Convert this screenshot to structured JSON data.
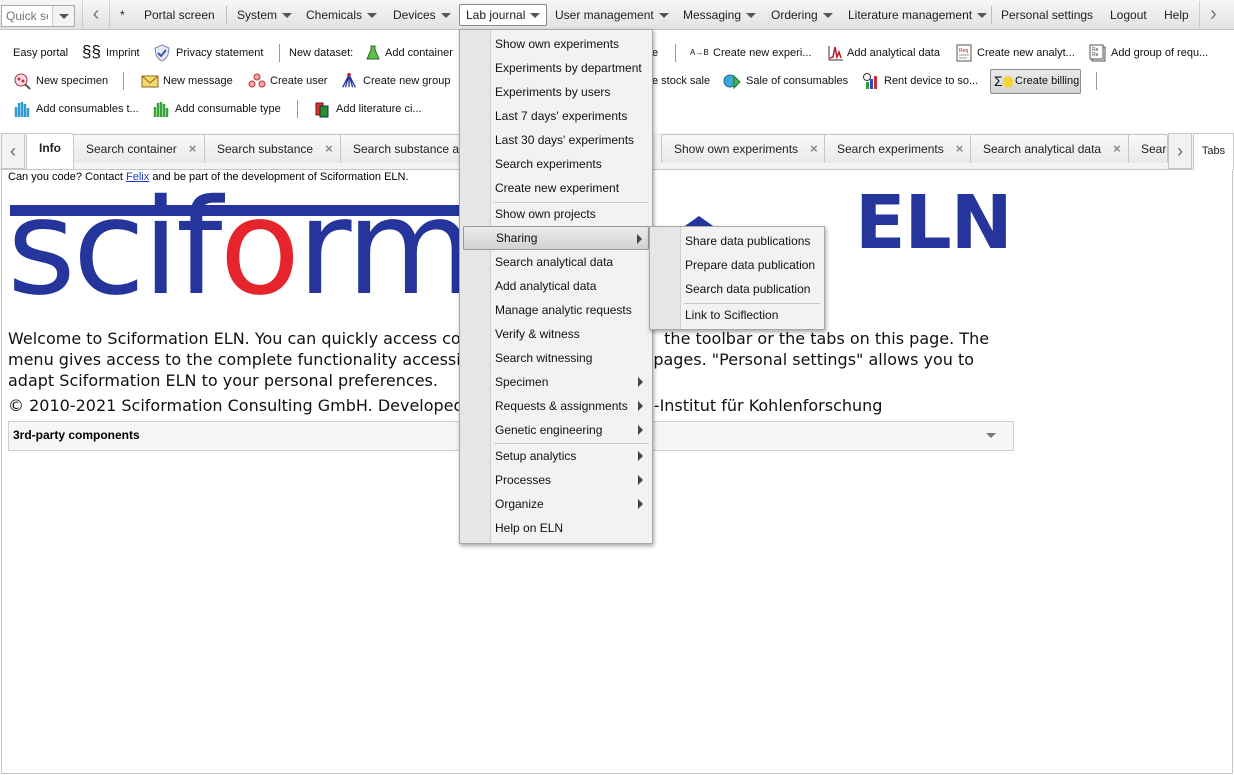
{
  "quick_search": {
    "placeholder": "Quick search"
  },
  "menubar": {
    "star": "*",
    "items": [
      {
        "label": "Portal screen"
      },
      {
        "label": "System"
      },
      {
        "label": "Chemicals"
      },
      {
        "label": "Devices"
      },
      {
        "label": "Lab journal"
      },
      {
        "label": "User management"
      },
      {
        "label": "Messaging"
      },
      {
        "label": "Ordering"
      },
      {
        "label": "Literature management"
      },
      {
        "label": "Personal settings"
      },
      {
        "label": "Logout"
      },
      {
        "label": "Help"
      }
    ]
  },
  "toolbar": {
    "row1": {
      "easy_portal": "Easy portal",
      "imprint": "Imprint",
      "privacy": "Privacy statement",
      "new_dataset": "New dataset:",
      "add_container": "Add container",
      "add_trunc": "e",
      "create_experiment": "Create new experi...",
      "add_analytical_data": "Add analytical data",
      "create_analytical": "Create new analyt...",
      "add_group_requests": "Add group of requ..."
    },
    "row2": {
      "new_specimen": "New specimen",
      "new_message": "New message",
      "create_user": "Create user",
      "create_group": "Create new group",
      "stock_sale": "e stock sale",
      "sale_consumables": "Sale of consumables",
      "rent_device": "Rent device to so...",
      "create_billing": "Create billing"
    },
    "row3": {
      "add_consumables": "Add consumables t...",
      "add_consumable_type": "Add consumable type",
      "add_literature": "Add literature ci..."
    }
  },
  "tabs": [
    {
      "label": "Info"
    },
    {
      "label": "Search container"
    },
    {
      "label": "Search substance"
    },
    {
      "label": "Search substance a"
    },
    {
      "label": "Show own experiments"
    },
    {
      "label": "Search experiments"
    },
    {
      "label": "Search analytical data"
    },
    {
      "label": "Searc"
    }
  ],
  "tabs_button": "Tabs",
  "content": {
    "contact_pre": "Can you code? Contact ",
    "contact_link": "Felix",
    "contact_post": " and be part of the development of Sciformation ELN.",
    "logo_eln": "ELN",
    "welcome": "Welcome to Sciformation ELN. You can quickly access co                                        the toolbar or the tabs on this page. The menu gives access to the complete functionality accessil                                     pages. \"Personal settings\" allows you to adapt Sciformation ELN to your personal preferences.",
    "copyright": "© 2010-2021 Sciformation Consulting GmbH. Developed                          -Planck-Institut für Kohlenforschung",
    "third_party": "3rd-party components"
  },
  "lab_journal_menu": {
    "items": [
      {
        "label": "Show own experiments"
      },
      {
        "label": "Experiments by department"
      },
      {
        "label": "Experiments by users"
      },
      {
        "label": "Last 7 days' experiments"
      },
      {
        "label": "Last 30 days' experiments"
      },
      {
        "label": "Search experiments"
      },
      {
        "label": "Create new experiment"
      },
      {
        "label": "Show own projects"
      },
      {
        "label": "Sharing"
      },
      {
        "label": "Search analytical data"
      },
      {
        "label": "Add analytical data"
      },
      {
        "label": "Manage analytic requests"
      },
      {
        "label": "Verify & witness"
      },
      {
        "label": "Search witnessing"
      },
      {
        "label": "Specimen"
      },
      {
        "label": "Requests & assignments"
      },
      {
        "label": "Genetic engineering"
      },
      {
        "label": "Setup analytics"
      },
      {
        "label": "Processes"
      },
      {
        "label": "Organize"
      },
      {
        "label": "Help on ELN"
      }
    ]
  },
  "sharing_submenu": {
    "items": [
      {
        "label": "Share data publications"
      },
      {
        "label": "Prepare data publication"
      },
      {
        "label": "Search data publication"
      },
      {
        "label": "Link to Sciflection"
      }
    ]
  },
  "colors": {
    "logo_blue": "#26359c",
    "logo_red": "#e5242b",
    "link": "#1a3cc5"
  }
}
